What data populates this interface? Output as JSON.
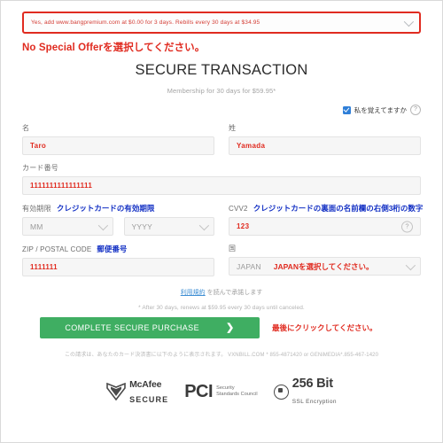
{
  "offer": {
    "selected_option": "Yes, add www.bangpremium.com at $0.00 for 3 days. Rebills every 30 days at $34.95",
    "annotation": "No Special Offerを選択してください。",
    "caret_icon": "chevron-down-icon"
  },
  "header": {
    "title": "SECURE TRANSACTION",
    "subtitle": "Membership for 30 days for $59.95*"
  },
  "remember": {
    "label": "私を覚えてますか",
    "checked": true,
    "help_icon": "question-mark-icon"
  },
  "form": {
    "first_name": {
      "label": "名",
      "value": "Taro"
    },
    "last_name": {
      "label": "姓",
      "value": "Yamada"
    },
    "card_number": {
      "label": "カード番号",
      "value": "1111111111111111"
    },
    "expiry": {
      "label": "有効期限",
      "annotation": "クレジットカードの有効期限",
      "month_value": "MM",
      "year_value": "YYYY"
    },
    "cvv2": {
      "label": "CVV2",
      "annotation": "クレジットカードの裏面の名前欄の右側3桁の数字",
      "value": "123",
      "help_icon": "question-mark-icon"
    },
    "zip": {
      "label": "ZIP / POSTAL CODE",
      "annotation": "郵便番号",
      "value": "1111111"
    },
    "country": {
      "label": "国",
      "value": "JAPAN",
      "annotation": "JAPANを選択してください。"
    }
  },
  "terms": {
    "link_text": "利用規約",
    "suffix": " を読んで承諾します"
  },
  "fineprint": "* After 30 days, renews at $59.95 every 30 days until canceled.",
  "purchase": {
    "button_label": "COMPLETE SECURE PURCHASE",
    "arrow_icon": "chevron-right-icon",
    "annotation": "最後にクリックしてください。"
  },
  "descriptor": "この請求は、あなたのカード決済書に以下のように表示されます。  VXNBILL.COM * 855-4871420 or GENiMEDIA*.855-467-1420",
  "badges": {
    "mcafee": {
      "icon": "mcafee-shield-icon",
      "top": "McAfee",
      "bottom": "SECURE",
      "tm": "™"
    },
    "pci": {
      "word": "PCI",
      "line1": "Security",
      "line2": "Standards Council"
    },
    "ssl": {
      "icon": "lock-icon",
      "top": "256 Bit",
      "bottom": "SSL Encryption"
    }
  },
  "colors": {
    "annotation_red": "#e02b20",
    "annotation_blue": "#1330c4",
    "button_green": "#3fae62",
    "checkbox_blue": "#2f7fd8"
  }
}
